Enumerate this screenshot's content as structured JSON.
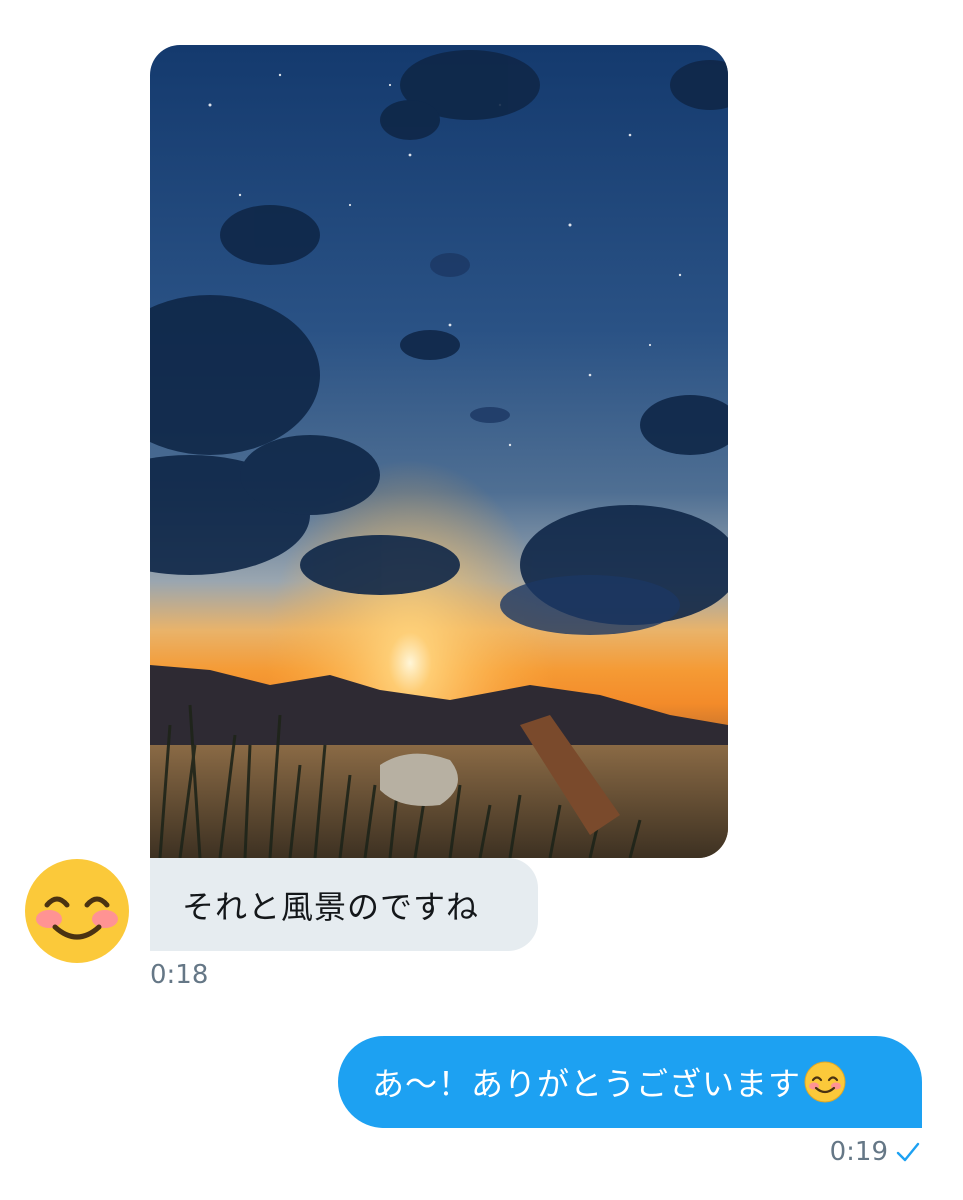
{
  "messages": {
    "incoming": {
      "image": {
        "icon": "sunset-landscape-artwork"
      },
      "avatar": {
        "icon": "smiling-face-with-smiling-eyes-emoji"
      },
      "text": "それと風景のですね",
      "time": "0:18"
    },
    "outgoing": {
      "text": "あ〜！ありがとうございます",
      "emoji": "smiling-face-with-smiling-eyes-emoji",
      "time": "0:19",
      "status_icon": "read-check-icon"
    }
  },
  "colors": {
    "incoming_bubble": "#e6ecf0",
    "outgoing_bubble": "#1da1f2",
    "timestamp": "#657786",
    "check": "#1da1f2"
  }
}
